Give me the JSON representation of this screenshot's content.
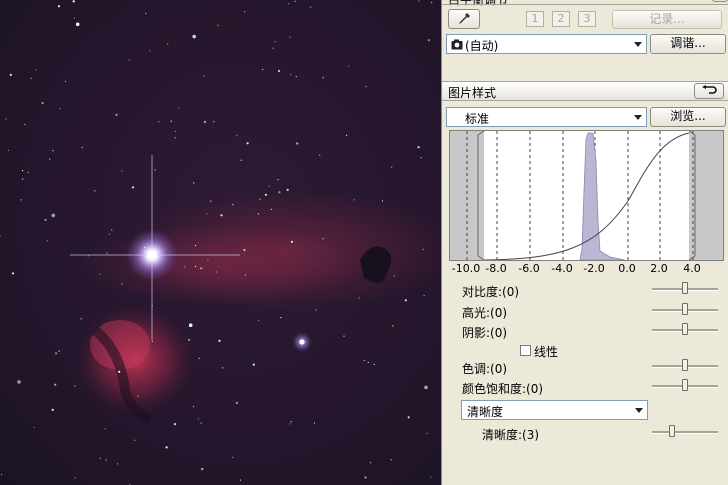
{
  "top_bar": {
    "title_fragment": "白平衡调节",
    "preset_numbers": [
      "1",
      "2",
      "3"
    ],
    "record_label": "记录...",
    "auto_wb_value": "(自动)",
    "adjust_label": "调谐..."
  },
  "picture_style": {
    "section_title": "图片样式",
    "style_value": "标准",
    "browse_label": "浏览...",
    "histogram_ticks": [
      "-10.0",
      "-8.0",
      "-6.0",
      "-4.0",
      "-2.0",
      "0.0",
      "2.0",
      "4.0"
    ]
  },
  "controls": {
    "contrast_label": "对比度:(0)",
    "highlight_label": "高光:(0)",
    "shadow_label": "阴影:(0)",
    "linear_label": "线性",
    "tone_label": "色调:(0)",
    "saturation_label": "颜色饱和度:(0)",
    "sharpness_mode_value": "清晰度",
    "sharpness_label": "清晰度:(3)"
  },
  "slider_levels": {
    "contrast": 0.5,
    "highlight": 0.5,
    "shadow": 0.5,
    "tone": 0.5,
    "saturation": 0.5,
    "sharpness": 0.3
  },
  "colors": {
    "histogram_fill": "#b9b7d4",
    "nebula": "#b0304e"
  }
}
